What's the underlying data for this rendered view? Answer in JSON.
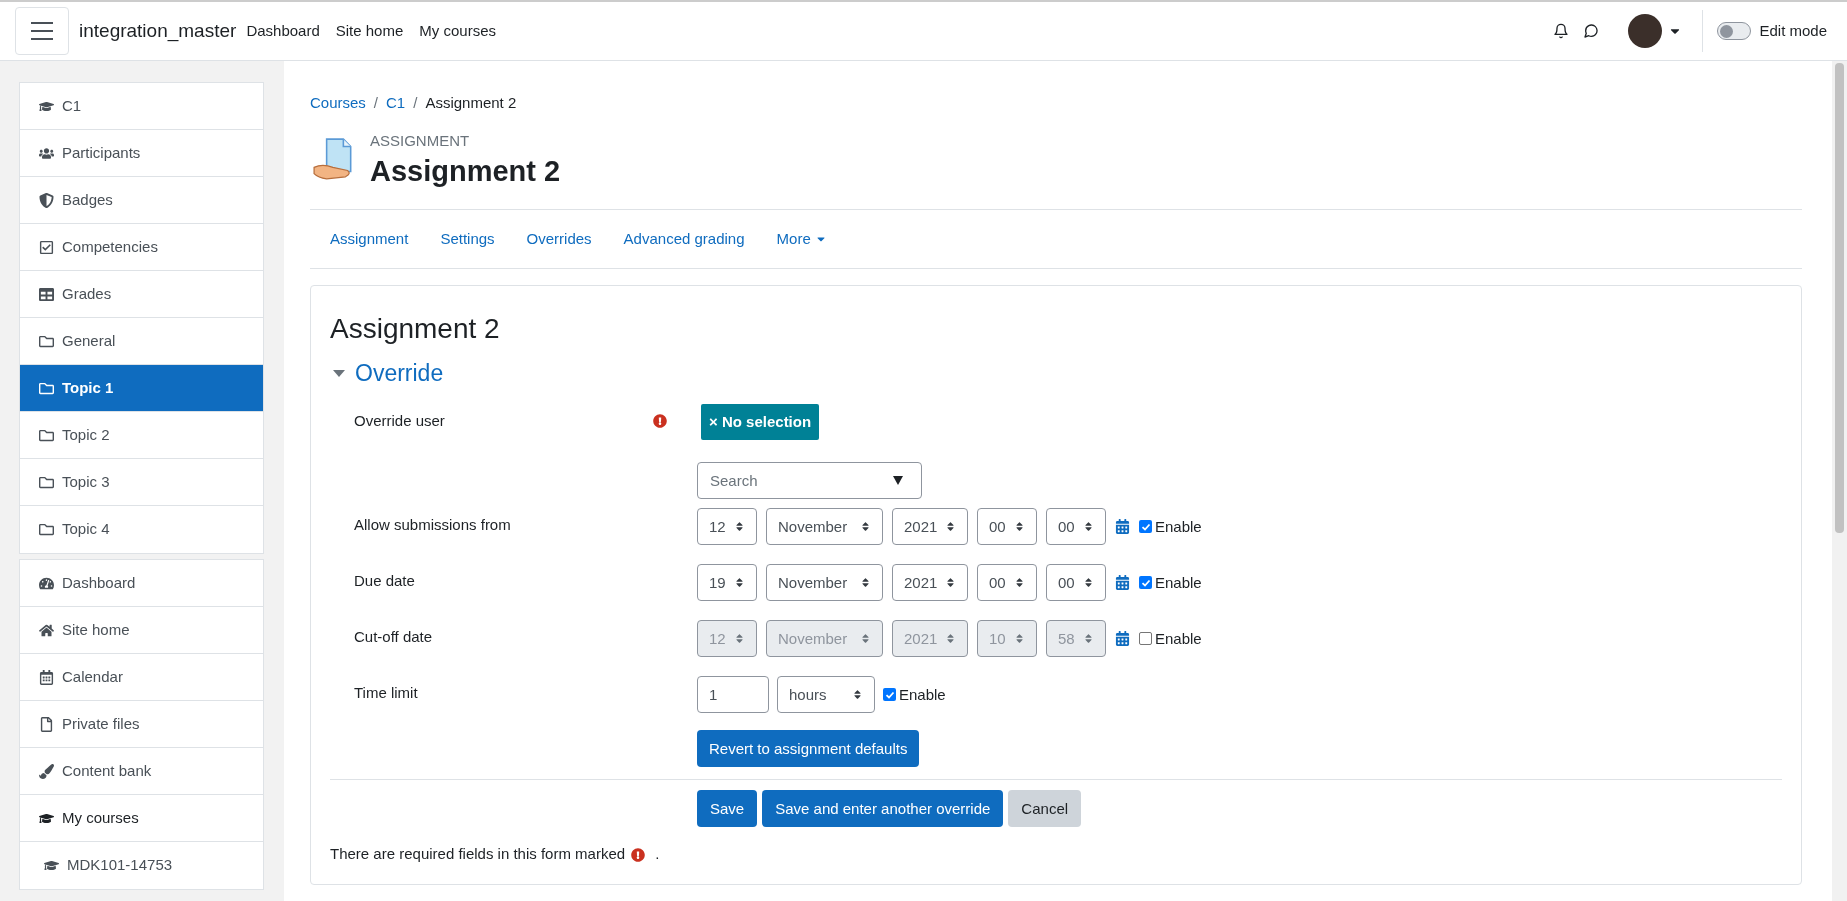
{
  "navbar": {
    "site_name": "integration_master",
    "links": [
      "Dashboard",
      "Site home",
      "My courses"
    ],
    "edit_mode": {
      "label": "Edit mode",
      "on": false
    }
  },
  "sidebar": {
    "groups": [
      {
        "items": [
          {
            "label": "C1",
            "kind": "link",
            "selected": false
          },
          {
            "label": "Participants",
            "kind": "link",
            "selected": false
          },
          {
            "label": "Badges",
            "kind": "link",
            "selected": false
          },
          {
            "label": "Competencies",
            "kind": "link",
            "selected": false
          },
          {
            "label": "Grades",
            "kind": "link",
            "selected": false
          },
          {
            "label": "General",
            "kind": "link",
            "selected": false
          },
          {
            "label": "Topic 1",
            "kind": "link",
            "selected": true
          },
          {
            "label": "Topic 2",
            "kind": "link",
            "selected": false
          },
          {
            "label": "Topic 3",
            "kind": "link",
            "selected": false
          },
          {
            "label": "Topic 4",
            "kind": "link",
            "selected": false
          }
        ]
      },
      {
        "items": [
          {
            "label": "Dashboard",
            "kind": "link",
            "selected": false
          },
          {
            "label": "Site home",
            "kind": "link",
            "selected": false
          },
          {
            "label": "Calendar",
            "kind": "link",
            "selected": false
          },
          {
            "label": "Private files",
            "kind": "link",
            "selected": false
          },
          {
            "label": "Content bank",
            "kind": "link",
            "selected": false
          },
          {
            "label": "My courses",
            "kind": "heading",
            "selected": false
          },
          {
            "label": "MDK101-14753",
            "kind": "child",
            "selected": false
          }
        ]
      }
    ]
  },
  "breadcrumb": {
    "links": [
      "Courses",
      "C1"
    ],
    "separators": [
      "/",
      "/"
    ],
    "current": "Assignment 2"
  },
  "header": {
    "kicker": "ASSIGNMENT",
    "title": "Assignment 2"
  },
  "tabs": [
    {
      "label": "Assignment",
      "dropdown": false
    },
    {
      "label": "Settings",
      "dropdown": false
    },
    {
      "label": "Overrides",
      "dropdown": false
    },
    {
      "label": "Advanced grading",
      "dropdown": false
    },
    {
      "label": "More",
      "dropdown": true
    }
  ],
  "form": {
    "title": "Assignment 2",
    "section": {
      "label": "Override",
      "expanded": true
    },
    "rows": [
      {
        "kind": "user",
        "label": "Override user",
        "required": true,
        "chip": "× No selection",
        "search": {
          "placeholder": "Search"
        }
      },
      {
        "kind": "date",
        "label": "Allow submissions from",
        "values": [
          "12",
          "November",
          "2021",
          "00",
          "00"
        ],
        "enable": {
          "label": "Enable",
          "checked": true
        }
      },
      {
        "kind": "date",
        "label": "Due date",
        "values": [
          "19",
          "November",
          "2021",
          "00",
          "00"
        ],
        "enable": {
          "label": "Enable",
          "checked": true
        }
      },
      {
        "kind": "date",
        "label": "Cut-off date",
        "values": [
          "12",
          "November",
          "2021",
          "10",
          "58"
        ],
        "enable": {
          "label": "Enable",
          "checked": false
        }
      },
      {
        "kind": "duration",
        "label": "Time limit",
        "value": "1",
        "unit": "hours",
        "enable": {
          "label": "Enable",
          "checked": true
        }
      }
    ],
    "revert_button": "Revert to assignment defaults",
    "buttons": [
      {
        "label": "Save",
        "kind": "primary"
      },
      {
        "label": "Save and enter another override",
        "kind": "primary"
      },
      {
        "label": "Cancel",
        "kind": "secondary"
      }
    ],
    "note": {
      "before": "There are required fields in this form marked",
      "after": "."
    }
  }
}
